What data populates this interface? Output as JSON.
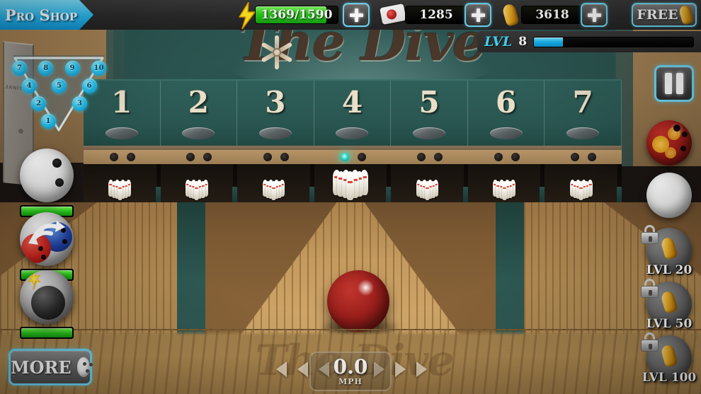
{
  "hud": {
    "pro_shop_label": "Pro Shop",
    "energy": {
      "icon": "lightning-bolt-icon",
      "value": "1369/1590",
      "current": 1369,
      "max": 1590,
      "fill_pct": 86,
      "color": "#2ecb1f"
    },
    "energy_plus_label": "+",
    "tickets": {
      "icon": "ticket-icon",
      "value": "1285"
    },
    "tickets_plus_label": "+",
    "pins": {
      "icon": "gold-pin-icon",
      "value": "3618"
    },
    "pins_plus_label": "+",
    "free_label": "FREE",
    "level": {
      "label": "LVL",
      "value": "8",
      "progress_pct": 18,
      "color": "#17b6ef"
    }
  },
  "signage": {
    "title": "The Dive"
  },
  "door": {
    "sign": "JANITOR"
  },
  "pin_rack": {
    "rows": [
      [
        "7",
        "8",
        "9",
        "10"
      ],
      [
        "4",
        "5",
        "6"
      ],
      [
        "2",
        "3"
      ],
      [
        "1"
      ]
    ],
    "standing_color": "#29c6f3"
  },
  "lanes": {
    "numbers": [
      "1",
      "2",
      "3",
      "4",
      "5",
      "6",
      "7"
    ],
    "active_lane": "4"
  },
  "powerups": [
    {
      "name": "white-ball-powerup",
      "meter_pct": 100
    },
    {
      "name": "swap-ball-powerup",
      "meter_pct": 100
    },
    {
      "name": "bomb-ball-powerup",
      "meter_pct": 100
    }
  ],
  "sidebar": {
    "pause_label": "II",
    "balls": [
      {
        "name": "red-floral-ball",
        "selected": true
      },
      {
        "name": "white-ball",
        "selected": false
      }
    ],
    "locked": [
      {
        "name": "locked-ball-lvl-20",
        "label": "LVL 20"
      },
      {
        "name": "locked-ball-lvl-50",
        "label": "LVL 50"
      },
      {
        "name": "locked-ball-lvl-100",
        "label": "LVL 100"
      }
    ]
  },
  "bottom": {
    "more_label": "MORE",
    "speed_value": "0.0",
    "speed_unit": "MPH",
    "left_arrows": 3,
    "right_arrows": 3
  }
}
